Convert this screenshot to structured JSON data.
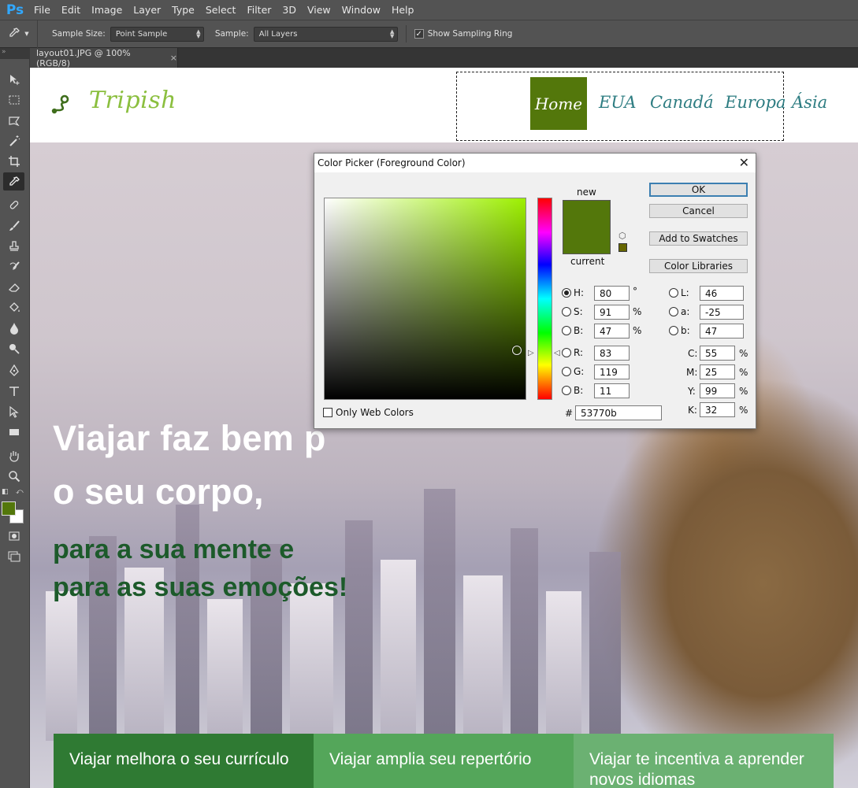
{
  "app": {
    "logo": "Ps",
    "menu": [
      "File",
      "Edit",
      "Image",
      "Layer",
      "Type",
      "Select",
      "Filter",
      "3D",
      "View",
      "Window",
      "Help"
    ]
  },
  "options": {
    "sample_size_label": "Sample Size:",
    "sample_size_value": "Point Sample",
    "sample_label": "Sample:",
    "sample_value": "All Layers",
    "sampling_ring_label": "Show Sampling Ring",
    "sampling_ring_checked": true
  },
  "document_tab": {
    "title": "layout01.JPG @ 100% (RGB/8)",
    "close": "×"
  },
  "toolbox": {
    "foreground_color": "#53770b",
    "background_color": "#ffffff",
    "active_tool": "eyedropper-icon"
  },
  "site": {
    "brand": "Tripish",
    "brand_color": "#8bbf3f",
    "nav": [
      "Home",
      "EUA",
      "Canadá",
      "Europa",
      "Ásia"
    ],
    "nav_active_color": "#53770b",
    "hero": {
      "line1": "Viajar faz bem p",
      "line2": "o seu corpo,",
      "line3": "para a sua mente e",
      "line4": "para as suas emoções!"
    },
    "features": [
      "Viajar melhora o seu currículo",
      "Viajar amplia seu repertório",
      "Viajar te incentiva a aprender novos idiomas"
    ]
  },
  "color_picker": {
    "title": "Color Picker (Foreground Color)",
    "close": "✕",
    "new_label": "new",
    "current_label": "current",
    "new_color": "#53770b",
    "current_color": "#53770b",
    "buttons": {
      "ok": "OK",
      "cancel": "Cancel",
      "add_to_swatches": "Add to Swatches",
      "color_libraries": "Color Libraries"
    },
    "hsb": {
      "H": "80",
      "S": "91",
      "B": "47"
    },
    "rgb": {
      "R": "83",
      "G": "119",
      "B": "11"
    },
    "lab": {
      "L": "46",
      "a": "-25",
      "b": "47"
    },
    "cmyk": {
      "C": "55",
      "M": "25",
      "Y": "99",
      "K": "32"
    },
    "hex": "53770b",
    "units": {
      "deg": "°",
      "pct": "%"
    },
    "only_web_colors": "Only Web Colors",
    "selected_channel": "H"
  }
}
